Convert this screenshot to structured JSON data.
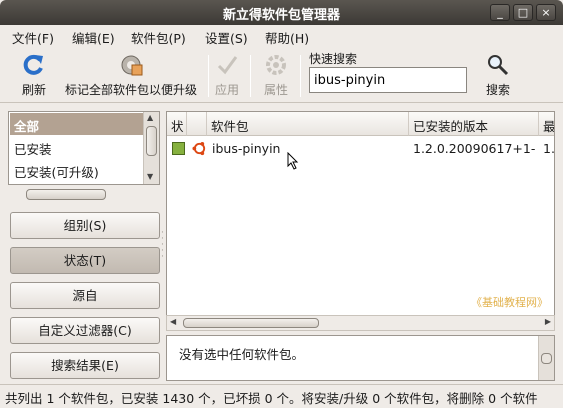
{
  "window": {
    "title": "新立得软件包管理器",
    "controls": [
      "_",
      "□",
      "×"
    ]
  },
  "menu": [
    "文件(F)",
    "编辑(E)",
    "软件包(P)",
    "设置(S)",
    "帮助(H)"
  ],
  "toolbar": {
    "refresh": "刷新",
    "mark_all_upgrades": "标记全部软件包以便升级",
    "apply": "应用",
    "properties": "属性",
    "quick_search_label": "快速搜索",
    "quick_search_value": "ibus-pinyin",
    "search": "搜索"
  },
  "filters": {
    "items": [
      "全部",
      "已安装",
      "已安装(可升级)"
    ],
    "selected_index": 0
  },
  "side_buttons": [
    "组别(S)",
    "状态(T)",
    "源自",
    "自定义过滤器(C)",
    "搜索结果(E)"
  ],
  "active_side_button": 1,
  "table": {
    "columns": [
      "状",
      "",
      "软件包",
      "已安装的版本",
      "最"
    ],
    "rows": [
      {
        "status_color": "#86b13f",
        "package": "ibus-pinyin",
        "installed_version": "1.2.0.20090617+1-",
        "latest": "1."
      }
    ]
  },
  "watermark": "《基础教程网》",
  "description": "没有选中任何软件包。",
  "statusbar": "共列出 1 个软件包，已安装 1430 个，已坏损 0 个。将安装/升级 0 个软件包，将删除 0 个软件"
}
